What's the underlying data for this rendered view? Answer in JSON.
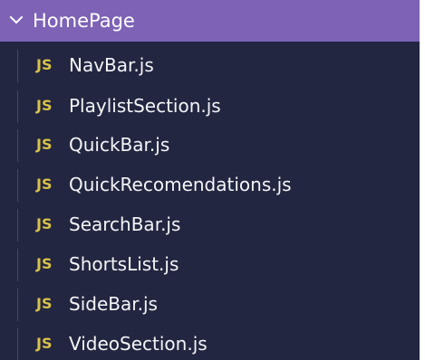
{
  "colors": {
    "panel_background": "#232640",
    "selected_folder_background": "#7d62b6",
    "file_text": "#f4f5f8",
    "js_icon": "#d8c24a"
  },
  "folder": {
    "name": "HomePage",
    "icon": "chevron-down-icon",
    "expanded": true
  },
  "files": [
    {
      "icon_label": "JS",
      "name": "NavBar.js"
    },
    {
      "icon_label": "JS",
      "name": "PlaylistSection.js"
    },
    {
      "icon_label": "JS",
      "name": "QuickBar.js"
    },
    {
      "icon_label": "JS",
      "name": "QuickRecomendations.js"
    },
    {
      "icon_label": "JS",
      "name": "SearchBar.js"
    },
    {
      "icon_label": "JS",
      "name": "ShortsList.js"
    },
    {
      "icon_label": "JS",
      "name": "SideBar.js"
    },
    {
      "icon_label": "JS",
      "name": "VideoSection.js"
    }
  ]
}
